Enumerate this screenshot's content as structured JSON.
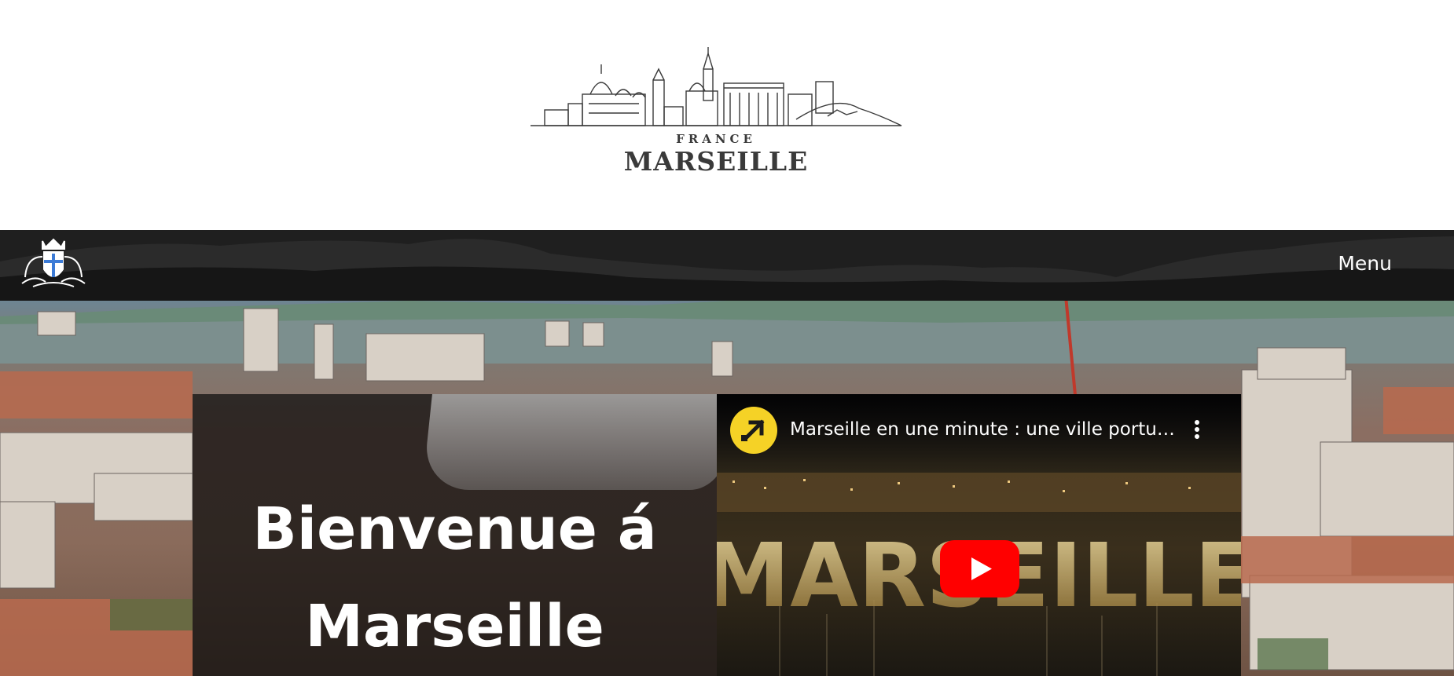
{
  "logo": {
    "country": "FRANCE",
    "city": "MARSEILLE"
  },
  "navbar": {
    "menu_label": "Menu",
    "coat_of_arms_icon": "marseille-coat-of-arms-icon"
  },
  "welcome": {
    "title_line1": "Bienvenue á",
    "title_line2": "Marseille"
  },
  "video": {
    "title": "Marseille en une minute : une ville portuaire",
    "channel_icon": "channel-arrow-icon",
    "more_icon": "more-vertical-icon",
    "play_icon": "youtube-play-icon",
    "thumbnail_word": "MARSEILLE"
  },
  "colors": {
    "nav_bg": "#1f1f1f",
    "youtube_red": "#ff0000",
    "channel_yellow": "#f5d226",
    "logo_ink": "#3a3a3a"
  }
}
